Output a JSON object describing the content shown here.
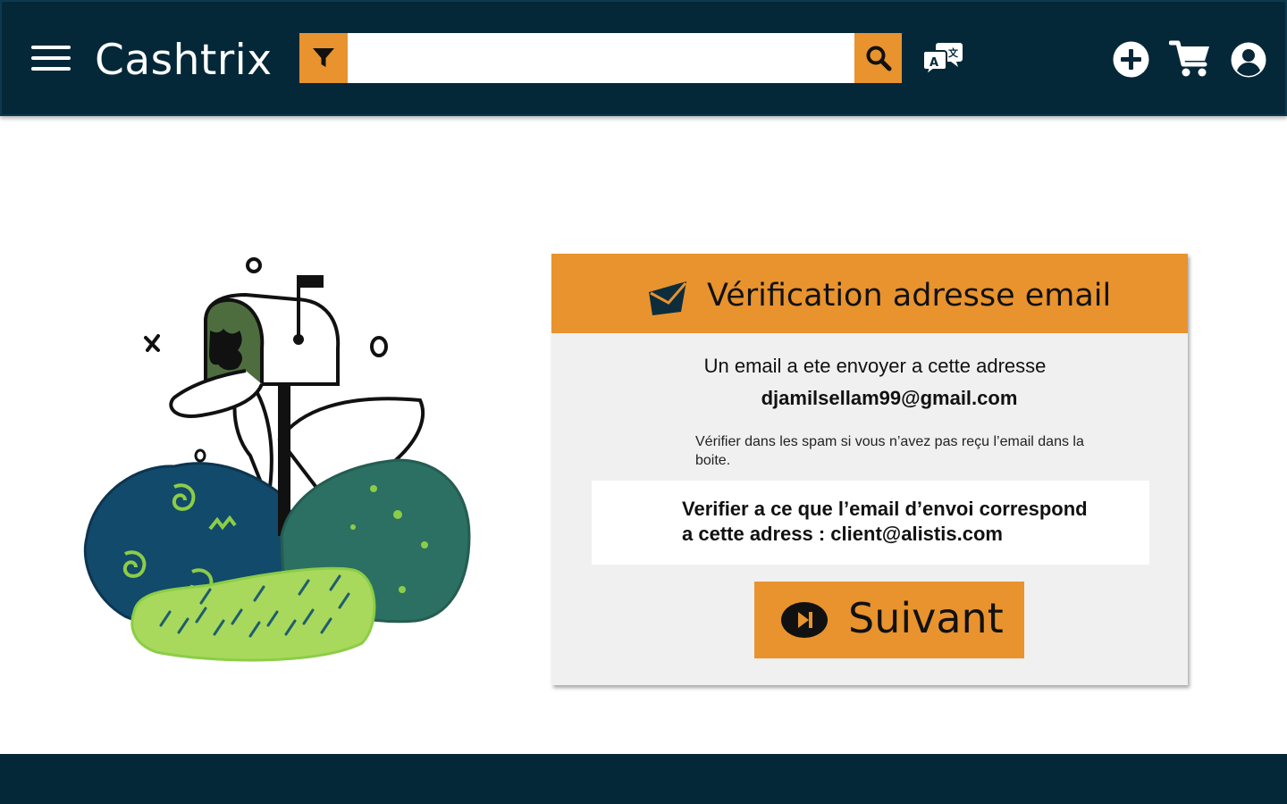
{
  "header": {
    "brand": "Cashtrix",
    "search_value": "",
    "search_placeholder": "",
    "icons": {
      "menu": "hamburger-menu-icon",
      "filter": "filter-funnel-icon",
      "search": "magnifier-icon",
      "translate": "translate-icon",
      "add": "plus-circle-icon",
      "cart": "shopping-cart-icon",
      "account": "user-circle-icon"
    }
  },
  "card": {
    "title": "Vérification adresse email",
    "line1": "Un email a ete envoyer a cette adresse",
    "email": "djamilsellam99@gmail.com",
    "spam_note": "Vérifier dans les spam  si vous n’avez pas reçu l’email dans la boite.",
    "verify_line1": "Verifier a ce que  l’email d’envoi correspond",
    "verify_line2": "a cette adress : client@alistis.com",
    "next_label": "Suivant",
    "icons": {
      "header": "envelope-icon",
      "next": "skip-forward-icon"
    }
  },
  "colors": {
    "navy": "#052838",
    "accent": "#e8932e",
    "card_bg": "#f0f0f0"
  }
}
